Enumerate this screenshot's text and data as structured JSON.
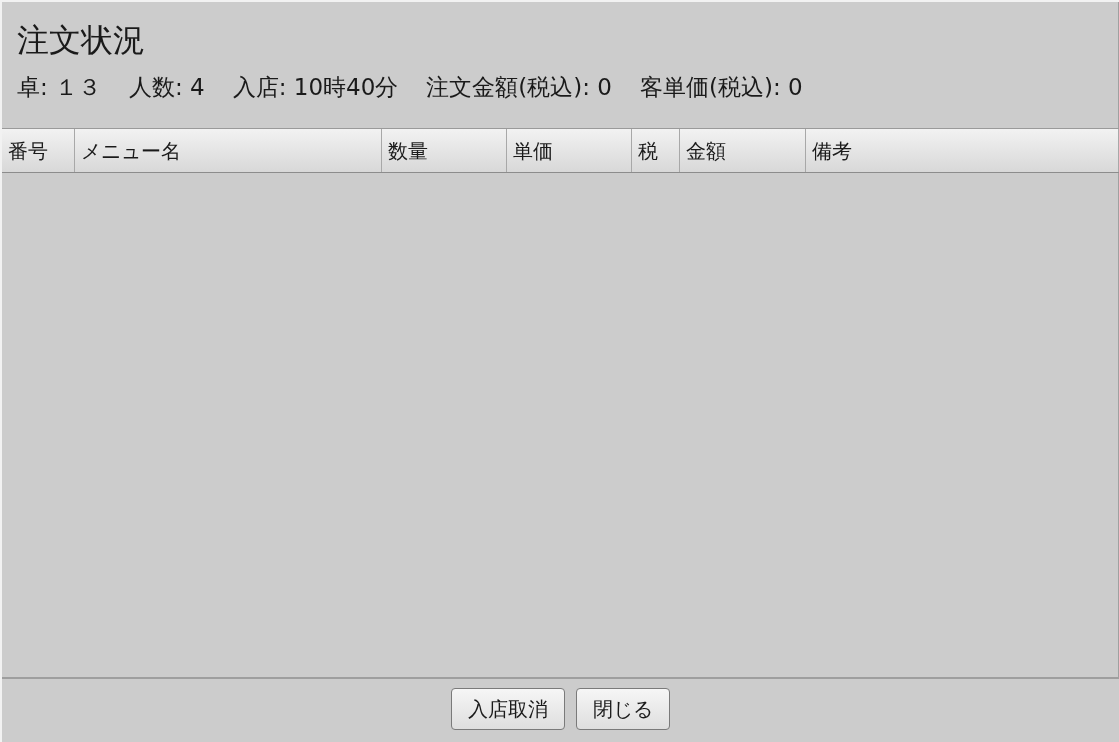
{
  "window": {
    "title": "注文状況"
  },
  "info": [
    "卓: １３",
    "人数: 4",
    "入店: 10時40分",
    "注文金額(税込): 0",
    "客単価(税込): 0"
  ],
  "table": {
    "columns": [
      "番号",
      "メニュー名",
      "数量",
      "単価",
      "税",
      "金額",
      "備考"
    ]
  },
  "buttons": [
    "入店取消",
    "閉じる"
  ]
}
